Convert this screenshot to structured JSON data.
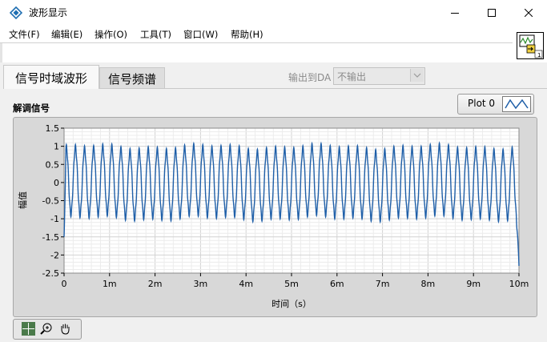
{
  "window": {
    "title": "波形显示"
  },
  "menu": [
    "文件(F)",
    "编辑(E)",
    "操作(O)",
    "工具(T)",
    "窗口(W)",
    "帮助(H)"
  ],
  "tabs": [
    {
      "label": "信号时域波形",
      "active": true
    },
    {
      "label": "信号频谱",
      "active": false
    }
  ],
  "da_output": {
    "label": "输出到DA",
    "selected": "不输出"
  },
  "graph": {
    "label": "解调信号",
    "legend": {
      "plot_name": "Plot 0"
    },
    "ylabel": "幅值",
    "xlabel": "时间（s）"
  },
  "colors": {
    "trace": "#1f5fa8",
    "plot_bg": "#ffffff",
    "frame": "#d8d8d8",
    "grid": "#e2e2e2"
  },
  "chart_data": {
    "type": "line",
    "xlabel": "时间（s）",
    "ylabel": "幅值",
    "xlim": [
      0,
      0.01
    ],
    "ylim": [
      -2.5,
      1.5
    ],
    "x_ticks": [
      "0",
      "1m",
      "2m",
      "3m",
      "4m",
      "5m",
      "6m",
      "7m",
      "8m",
      "9m",
      "10m"
    ],
    "y_ticks": [
      "1.5",
      "1",
      "0.5",
      "0",
      "-0.5",
      "-1",
      "-1.5",
      "-2",
      "-2.5"
    ],
    "grid": true,
    "series": [
      {
        "cycles": 50,
        "amplitude": 1.0,
        "x_start": 0,
        "x_end": 0.01,
        "start_value": -1.5,
        "end_value": -2.3
      }
    ]
  }
}
